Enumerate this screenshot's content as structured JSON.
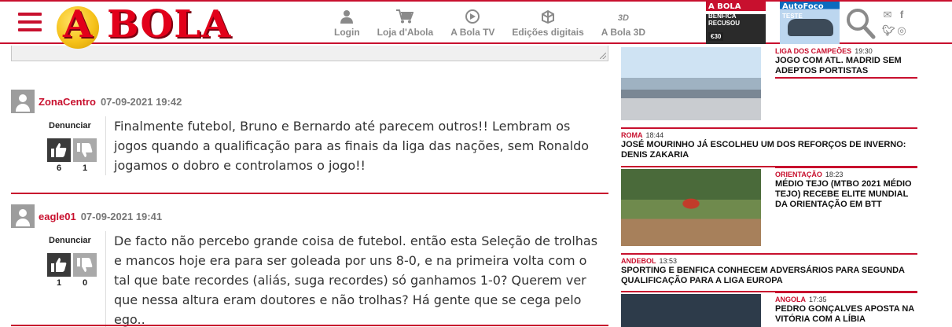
{
  "header": {
    "logo_text": "A BOLA",
    "nav": [
      {
        "label": "Login",
        "icon": "user-icon"
      },
      {
        "label": "Loja d'Abola",
        "icon": "cart-icon"
      },
      {
        "label": "A Bola TV",
        "icon": "tv-icon"
      },
      {
        "label": "Edições digitais",
        "icon": "gift-icon"
      },
      {
        "label": "A Bola 3D",
        "icon": "3d-icon",
        "glyph": "3D"
      }
    ],
    "covers": [
      {
        "brand": "A BOLA",
        "headline": "BENFICA RECUSOU",
        "price": "€30"
      },
      {
        "brand": "AutoFoco",
        "headline": "TESTE",
        "price": ""
      }
    ],
    "social": [
      "mail-icon",
      "facebook-icon",
      "twitter-icon",
      "instagram-icon"
    ]
  },
  "comments": [
    {
      "username": "ZonaCentro",
      "datetime": "07-09-2021 19:42",
      "report_label": "Denunciar",
      "likes": "6",
      "dislikes": "1",
      "text": "Finalmente futebol, Bruno e Bernardo até parecem outros!! Lembram os jogos quando a qualificação para as finais da liga das nações, sem Ronaldo jogamos o dobro e controlamos o jogo!!"
    },
    {
      "username": "eagle01",
      "datetime": "07-09-2021 19:41",
      "report_label": "Denunciar",
      "likes": "1",
      "dislikes": "0",
      "text": "De facto não percebo grande coisa de futebol. então esta Seleção de trolhas e mancos hoje era para ser goleada por uns 8-0, e na primeira volta com o tal que bate recordes (aliás, suga recordes) só ganhamos 1-0? Querem ver que nessa altura eram doutores e não trolhas? Há gente que se cega pelo ego.."
    }
  ],
  "news": [
    {
      "category": "LIGA DOS CAMPEÕES",
      "time": "19:30",
      "title": "JOGO COM ATL. MADRID SEM ADEPTOS PORTISTAS"
    },
    {
      "category": "ROMA",
      "time": "18:44",
      "title": "JOSÉ MOURINHO JÁ ESCOLHEU UM DOS REFORÇOS DE INVERNO: DENIS ZAKARIA"
    },
    {
      "category": "ORIENTAÇÃO",
      "time": "18:23",
      "title": "MÉDIO TEJO (MTBO 2021 MÉDIO TEJO) RECEBE ELITE MUNDIAL DA ORIENTAÇÃO EM BTT"
    },
    {
      "category": "ANDEBOL",
      "time": "13:53",
      "title": "SPORTING E BENFICA CONHECEM ADVERSÁRIOS PARA SEGUNDA QUALIFICAÇÃO PARA A LIGA EUROPA"
    },
    {
      "category": "ANGOLA",
      "time": "17:35",
      "title": "PEDRO GONÇALVES APOSTA NA VITÓRIA COM A LÍBIA"
    }
  ],
  "colors": {
    "brand_red": "#c8102e",
    "text_gray": "#8a8a8a"
  }
}
